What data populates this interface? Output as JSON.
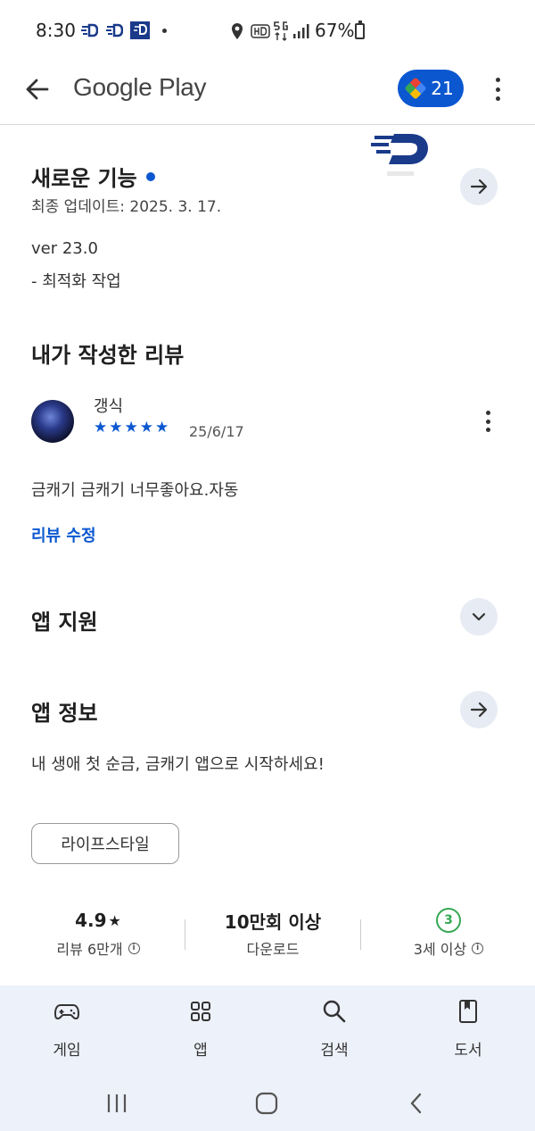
{
  "status_bar": {
    "time": "8:30",
    "battery": "67%"
  },
  "app_bar": {
    "title": "Google Play",
    "points": "21"
  },
  "whats_new": {
    "title": "새로운 기능",
    "updated": "최종 업데이트: 2025. 3. 17.",
    "version": "ver 23.0",
    "note": "- 최적화 작업"
  },
  "my_review": {
    "heading": "내가 작성한 리뷰",
    "author": "갱식",
    "stars": 5,
    "date": "25/6/17",
    "text": "금캐기 금캐기 너무좋아요.자동",
    "edit_label": "리뷰 수정"
  },
  "app_support": {
    "title": "앱 지원"
  },
  "app_info": {
    "title": "앱 정보",
    "description": "내 생애 첫 순금, 금캐기 앱으로 시작하세요!",
    "category": "라이프스타일"
  },
  "stats": {
    "rating": "4.9",
    "rating_label": "리뷰 6만개",
    "downloads": "10만회 이상",
    "downloads_label": "다운로드",
    "age_badge": "3",
    "age_label": "3세 이상"
  },
  "bottom_nav": {
    "items": [
      {
        "label": "게임",
        "icon": "gamepad-icon"
      },
      {
        "label": "앱",
        "icon": "apps-grid-icon"
      },
      {
        "label": "검색",
        "icon": "search-icon"
      },
      {
        "label": "도서",
        "icon": "book-icon"
      }
    ]
  },
  "colors": {
    "accent": "#0b57d0",
    "age_green": "#34a853",
    "nav_bg": "#edf1f9"
  }
}
